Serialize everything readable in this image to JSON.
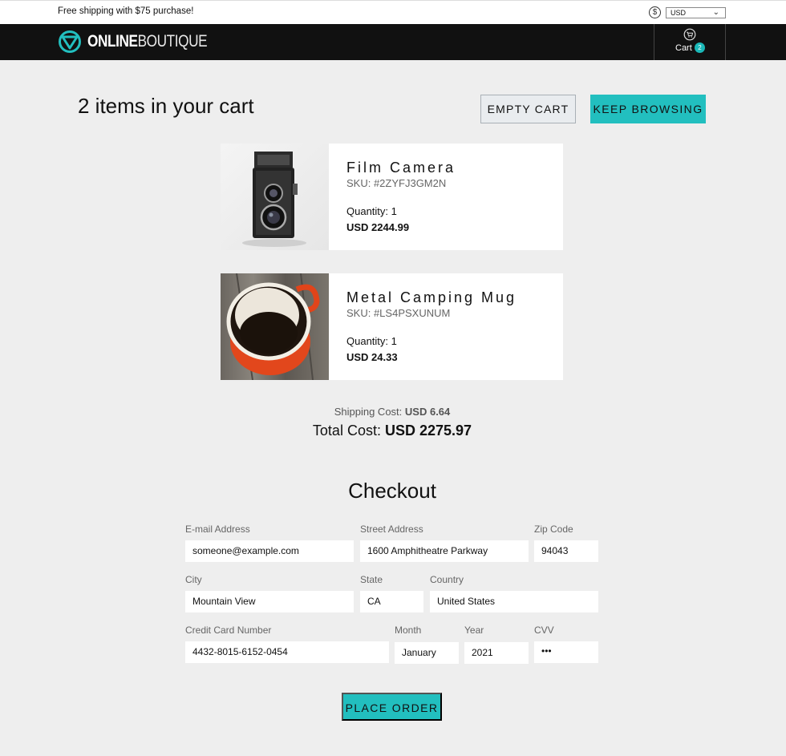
{
  "topbar": {
    "promo": "Free shipping with $75 purchase!",
    "currency_icon": "dollar-circle-icon",
    "currency_value": "USD"
  },
  "navbar": {
    "logo_bold": "ONLINE",
    "logo_thin": "BOUTIQUE",
    "cart_label": "Cart",
    "cart_count": "2"
  },
  "cart": {
    "title": "2 items in your cart",
    "empty_label": "EMPTY CART",
    "keep_label": "KEEP BROWSING",
    "items": [
      {
        "name": "Film Camera",
        "sku": "SKU: #2ZYFJ3GM2N",
        "quantity": "Quantity: 1",
        "price": "USD 2244.99",
        "image": "film-camera"
      },
      {
        "name": "Metal Camping Mug",
        "sku": "SKU: #LS4PSXUNUM",
        "quantity": "Quantity: 1",
        "price": "USD 24.33",
        "image": "camping-mug"
      }
    ],
    "shipping_label": "Shipping Cost:",
    "shipping_value": "USD 6.64",
    "total_label": "Total Cost:",
    "total_value": "USD 2275.97"
  },
  "checkout": {
    "title": "Checkout",
    "fields": {
      "email": {
        "label": "E-mail Address",
        "value": "someone@example.com"
      },
      "street": {
        "label": "Street Address",
        "value": "1600 Amphitheatre Parkway"
      },
      "zip": {
        "label": "Zip Code",
        "value": "94043"
      },
      "city": {
        "label": "City",
        "value": "Mountain View"
      },
      "state": {
        "label": "State",
        "value": "CA"
      },
      "country": {
        "label": "Country",
        "value": "United States"
      },
      "card": {
        "label": "Credit Card Number",
        "value": "4432-8015-6152-0454"
      },
      "month": {
        "label": "Month",
        "value": "January"
      },
      "year": {
        "label": "Year",
        "value": "2021"
      },
      "cvv": {
        "label": "CVV",
        "value": "•••"
      }
    },
    "place_order": "PLACE ORDER"
  }
}
